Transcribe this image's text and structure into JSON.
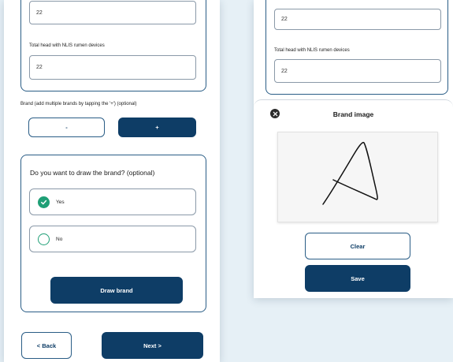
{
  "left_screen": {
    "field_top_value": "22",
    "field_label": "Total head with NLIS rumen devices",
    "field_value": "22",
    "brand_label": "Brand (add multiple brands by tapping the '+') (optional)",
    "minus_label": "-",
    "plus_label": "+",
    "draw_question": "Do you want to draw the brand? (optional)",
    "options": [
      {
        "label": "Yes",
        "selected": true
      },
      {
        "label": "No",
        "selected": false
      }
    ],
    "draw_button": "Draw brand",
    "back_button": "< Back",
    "next_button": "Next >"
  },
  "right_screen": {
    "field_top_value": "22",
    "field_label": "Total head with NLIS rumen devices",
    "field_value": "22",
    "modal_title": "Brand image",
    "clear_button": "Clear",
    "save_button": "Save"
  },
  "colors": {
    "navy": "#0e3d66",
    "accent_green": "#1f9f76",
    "background": "#e6f0f6"
  },
  "icons": [
    "checkmark-icon",
    "close-icon"
  ]
}
